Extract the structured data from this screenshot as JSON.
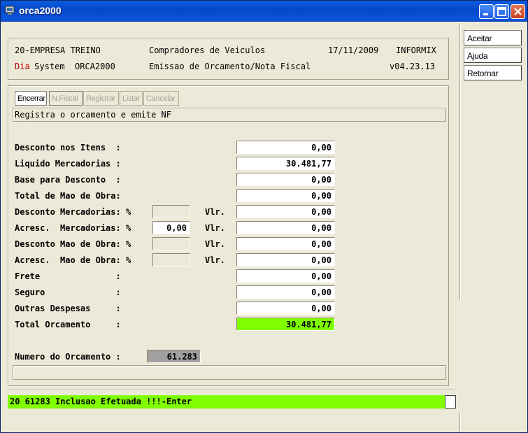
{
  "window": {
    "title": "orca2000"
  },
  "header": {
    "company": "20-EMPRESA TREINO",
    "module": "Compradores de Veiculos",
    "date": "17/11/2009",
    "db": "INFORMIX",
    "system_prefix": "Dia",
    "system_rest": " System  ORCA2000",
    "screen": "Emissao de Orcamento/Nota Fiscal",
    "version": "v04.23.13"
  },
  "side_buttons": [
    "Aceitar",
    "Ajuda",
    "Retornar"
  ],
  "toolbar": [
    "Encerrar",
    "N.Fiscal",
    "Registrar",
    "Listar",
    "Cancelar"
  ],
  "hint": "Registra o orcamento e emite NF",
  "rows": [
    {
      "label": "Desconto nos Itens  :",
      "value": "0,00"
    },
    {
      "label": "Liquido Mercadorias :",
      "value": "30.481,77"
    },
    {
      "label": "Base para Desconto  :",
      "value": "0,00"
    },
    {
      "label": "Total de Mao de Obra:",
      "value": "0,00"
    },
    {
      "label": "Desconto Mercadorias: %",
      "pct": "",
      "vlr": "Vlr.",
      "value": "0,00"
    },
    {
      "label": "Acresc.  Mercadorias: %",
      "pct": "0,00",
      "vlr": "Vlr.",
      "value": "0,00"
    },
    {
      "label": "Desconto Mao de Obra: %",
      "pct": "",
      "vlr": "Vlr.",
      "value": "0,00"
    },
    {
      "label": "Acresc.  Mao de Obra: %",
      "pct": "",
      "vlr": "Vlr.",
      "value": "0,00"
    },
    {
      "label": "Frete               :",
      "value": "0,00"
    },
    {
      "label": "Seguro              :",
      "value": "0,00"
    },
    {
      "label": "Outras Despesas     :",
      "value": "0,00"
    },
    {
      "label": "Total Orcamento     :",
      "value": "30.481,77"
    }
  ],
  "numero": {
    "label": "Numero do Orcamento :",
    "value": "61.283"
  },
  "status": "20 61283 Inclusao Efetuada !!!-Enter",
  "colors": {
    "total_bg": "#80ff00",
    "status_bg": "#80ff00",
    "title_bar": "#0a5ce0"
  }
}
